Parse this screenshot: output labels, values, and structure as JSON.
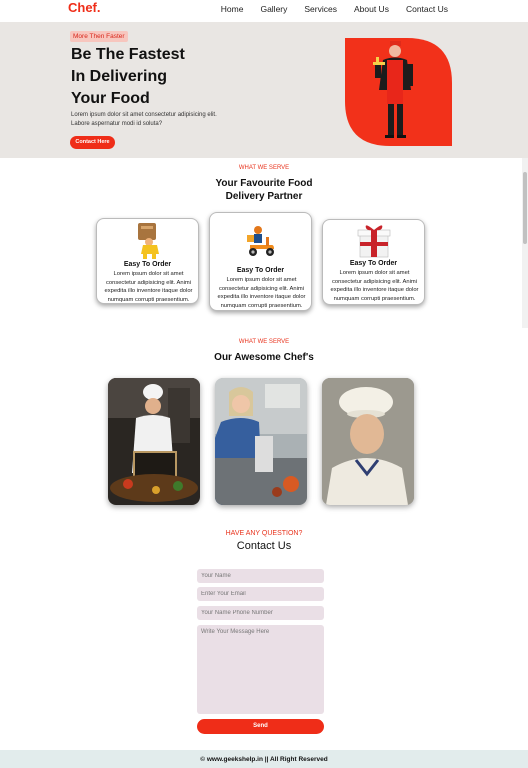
{
  "nav": {
    "logo": "Chef.",
    "items": [
      "Home",
      "Gallery",
      "Services",
      "About Us",
      "Contact Us"
    ]
  },
  "hero": {
    "badge": "More Then Faster",
    "title_lines": [
      "Be The Fastest",
      "In Delivering",
      "Your Food"
    ],
    "text": "Lorem ipsum dolor sit amet consectetur adipisicing elit. Labore aspernatur modi id soluta?",
    "button": "Contact Here"
  },
  "serve": {
    "eyebrow": "WHAT WE SERVE",
    "heading_lines": [
      "Your Favourite Food",
      "Delivery Partner"
    ],
    "cards": [
      {
        "title": "Easy To Order",
        "text": "Lorem ipsum dolor sit amet consectetur adipisicing elit. Animi expedita illo inventore itaque dolor numquam corrupti praesentium.",
        "icon": "courier-bag-icon"
      },
      {
        "title": "Easy To Order",
        "text": "Lorem ipsum dolor sit amet consectetur adipisicing elit. Animi expedita illo inventore itaque dolor numquam corrupti praesentium.",
        "icon": "scooter-delivery-icon"
      },
      {
        "title": "Easy To Order",
        "text": "Lorem ipsum dolor sit amet consectetur adipisicing elit. Animi expedita illo inventore itaque dolor numquam corrupti praesentium.",
        "icon": "gift-box-icon"
      }
    ]
  },
  "chefs": {
    "eyebrow": "WHAT WE SERVE",
    "heading": "Our Awesome Chef's"
  },
  "contact": {
    "eyebrow": "HAVE ANY QUESTION?",
    "heading": "Contact Us",
    "name_placeholder": "Your Name",
    "email_placeholder": "Enter Your Email",
    "phone_placeholder": "Your Name Phone Number",
    "message_placeholder": "Write Your Message Here",
    "send": "Send"
  },
  "footer": {
    "text": "© www.geekshelp.in || All Right Reserved"
  },
  "colors": {
    "accent": "#ef2d18",
    "hero_bg": "#e9e6e3",
    "field_bg": "#eadfe6",
    "footer_bg": "#e2ecec"
  }
}
